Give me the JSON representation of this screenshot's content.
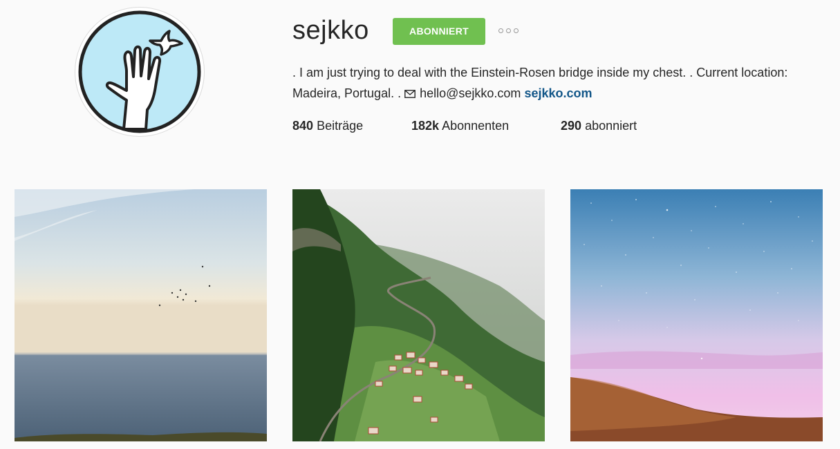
{
  "profile": {
    "username": "sejkko",
    "follow_label": "ABONNIERT",
    "bio_text": ". I am just trying to deal with the Einstein-Rosen bridge inside my chest. . Current location: Madeira, Portugal. . ",
    "email": "hello@sejkko.com",
    "website": "sejkko.com"
  },
  "stats": {
    "posts_count": "840",
    "posts_label": "Beiträge",
    "followers_count": "182k",
    "followers_label": "Abonnenten",
    "following_count": "290",
    "following_label": "abonniert"
  },
  "colors": {
    "accent": "#70c050",
    "link": "#125688",
    "avatar_bg": "#bde9f7"
  },
  "icons": {
    "more": "three-dots-icon",
    "mail": "envelope-icon",
    "avatar": "hand-with-bird-logo"
  },
  "posts": [
    {
      "subject": "ocean-horizon-with-birds"
    },
    {
      "subject": "green-valley-village"
    },
    {
      "subject": "starry-pink-sky-hillside"
    }
  ]
}
